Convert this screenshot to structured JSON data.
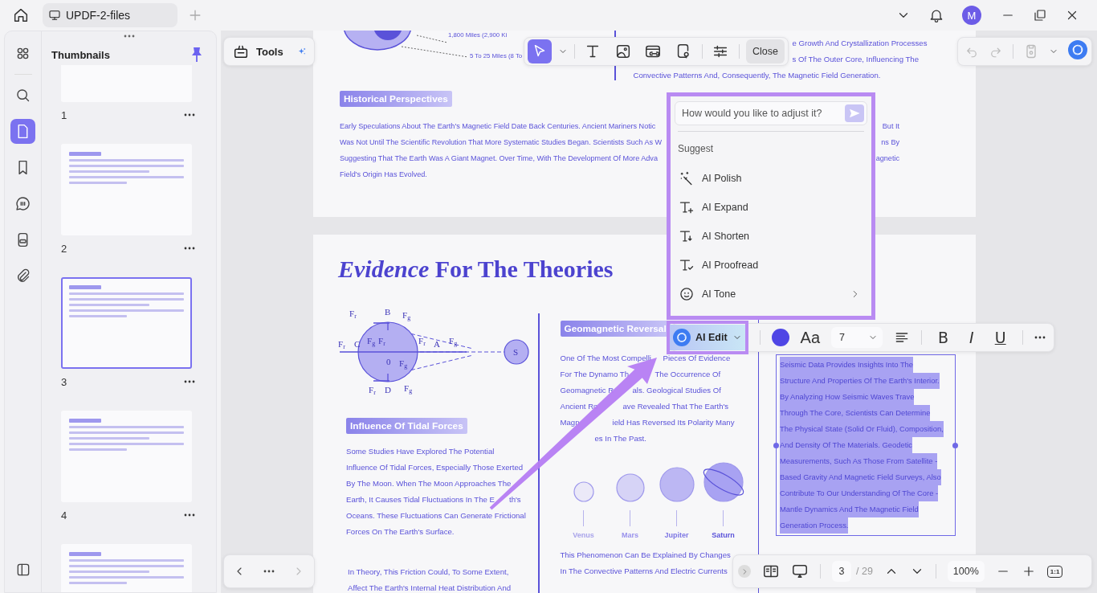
{
  "title_bar": {
    "tab": {
      "title": "UPDF-2-files",
      "selected": true
    },
    "avatar": "M"
  },
  "rail": {
    "items": [
      {
        "kind": "apps",
        "selected": false
      },
      {
        "kind": "search",
        "selected": false
      },
      {
        "kind": "pages",
        "selected": true
      },
      {
        "kind": "bookmark",
        "selected": false
      },
      {
        "kind": "comment",
        "selected": false
      },
      {
        "kind": "stamp",
        "selected": false
      },
      {
        "kind": "attachment",
        "selected": false
      }
    ]
  },
  "thumbnails": {
    "title": "Thumbnails",
    "pages": [
      {
        "number": "1",
        "selected": false
      },
      {
        "number": "2",
        "selected": false
      },
      {
        "number": "3",
        "selected": true
      },
      {
        "number": "4",
        "selected": false
      },
      {
        "selected": false
      }
    ]
  },
  "tools_panel": {
    "label": "Tools"
  },
  "edit_toolbar": {
    "tools": [
      {
        "kind": "select",
        "selected": true
      },
      {
        "kind": "text",
        "selected": false
      },
      {
        "kind": "image",
        "selected": false
      },
      {
        "kind": "link",
        "selected": false
      },
      {
        "kind": "watermark",
        "selected": false
      },
      {
        "kind": "properties",
        "selected": false
      }
    ],
    "close": "Close"
  },
  "history": [
    {
      "kind": "undo",
      "disabled": true
    },
    {
      "kind": "redo",
      "disabled": true
    }
  ],
  "page_1": {
    "callouts": [
      "1,800 Miles (2,900 Ki",
      "5 To 25 Miles (8 To"
    ],
    "column_lines": [
      "e Growth And Crystallization Processes",
      "s Of The Outer Core, Influencing The",
      "Convective Patterns And, Consequently, The Magnetic Field Generation."
    ],
    "heading": "Historical Perspectives",
    "lines": [
      [
        "Early Speculations About The Earth's Magnetic Field Date Back Centuries. Ancient Mariners Notic",
        "But It"
      ],
      [
        "Was Not Until The Scientific Revolution That More Systematic Studies Began. Scientists Such As W",
        "ns By"
      ],
      [
        "Suggesting That The Earth Was A Giant Magnet. Over Time, With The Development Of More Adva",
        "agnetic"
      ],
      [
        "Field's Origin Has Evolved."
      ]
    ]
  },
  "page_2": {
    "title": "*Evidence* For The Theories",
    "diagram_labels": [
      {
        "text": "F",
        "sub": "r"
      },
      {
        "text": "B"
      },
      {
        "text": "F",
        "sub": "g"
      },
      {
        "text": "F",
        "sub": "r"
      },
      {
        "text": "C"
      },
      {
        "text": "F",
        "sub": "g"
      },
      {
        "text": "F",
        "sub": "r"
      },
      {
        "text": "F",
        "sub": "r"
      },
      {
        "text": "A"
      },
      {
        "text": "F",
        "sub": "g"
      },
      {
        "text": "0"
      },
      {
        "text": "F",
        "sub": "g"
      },
      {
        "text": "F",
        "sub": "r"
      },
      {
        "text": "D"
      },
      {
        "text": "F",
        "sub": "g"
      },
      {
        "text": "S"
      }
    ],
    "left": {
      "heading": "Influence Of Tidal Forces",
      "lines": [
        [
          "Some Studies Have Explored The Potential"
        ],
        [
          "Influence Of Tidal Forces, Especially Those Exerted"
        ],
        [
          "By The Moon. When The Moon Approaches The"
        ],
        [
          "Earth, It Causes Tidal Fluctuations In The E",
          "th's"
        ],
        [
          "Oceans. These Fluctuations Can Generate Frictional"
        ],
        [
          "Forces On The Earth's Surface."
        ]
      ],
      "more_lines": [
        "In Theory, This Friction Could, To Some Extent,",
        "Affect The Earth's Internal Heat Distribution And"
      ]
    },
    "middle": {
      "heading": "Geomagnetic Reversal",
      "lines": [
        [
          "One Of The Most Compelli",
          "Pieces Of Evidence"
        ],
        [
          "For The Dynamo Th",
          "The Occurrence Of"
        ],
        [
          "Geomagnetic R",
          "als. Geological Studies Of"
        ],
        [
          "Ancient Ro",
          "ave Revealed That The Earth's"
        ],
        [
          "Magn",
          "ield Has Reversed Its Polarity Many"
        ],
        [
          "es In The Past."
        ]
      ],
      "planets": [
        {
          "name": "Venus"
        },
        {
          "name": "Mars"
        },
        {
          "name": "Jupiter"
        },
        {
          "name": "Saturn",
          "ring": true
        }
      ],
      "more_lines": [
        "This Phenomenon Can Be Explained By Changes",
        "In The Convective Patterns And Electric Currents"
      ]
    },
    "selected_text": [
      "Seismic Data Provides Insights Into The",
      "Structure And Properties Of The Earth's Interior.",
      "By Analyzing How Seismic Waves Trave",
      "Through The Core, Scientists Can Determine",
      "The Physical State (Solid Or Fluid), Composition,",
      "And Density Of The Materials. Geodetic",
      "Measurements, Such As Those From Satellite -",
      "Based Gravity And Magnetic Field Surveys, Also",
      "Contribute To Our Understanding Of The Core -",
      "Mantle Dynamics And The Magnetic Field",
      "Generation Process."
    ]
  },
  "ai_popup": {
    "placeholder": "How would you like to adjust it?",
    "section": "Suggest",
    "items": [
      {
        "kind": "polish",
        "label": "AI Polish"
      },
      {
        "kind": "expand",
        "label": "AI Expand"
      },
      {
        "kind": "shorten",
        "label": "AI Shorten"
      },
      {
        "kind": "proofread",
        "label": "AI Proofread"
      },
      {
        "kind": "tone",
        "label": "AI Tone",
        "submenu": true
      }
    ]
  },
  "format_toolbar": {
    "ai_edit": "AI Edit",
    "color": "#4f46e5",
    "font_button": "Aa",
    "font_size": "7",
    "styles": [
      "B",
      "I",
      "U"
    ]
  },
  "page_nav": {
    "page": "3",
    "total": "/ 29",
    "zoom": "100%",
    "fit": "1:1"
  }
}
